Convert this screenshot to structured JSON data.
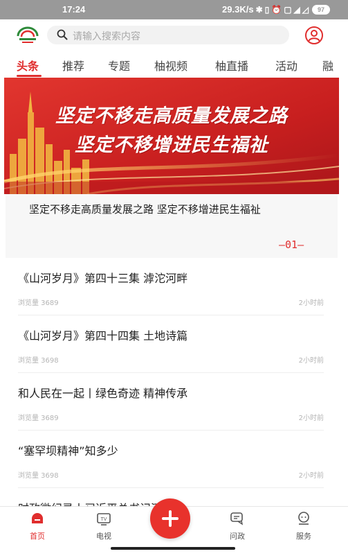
{
  "status_bar": {
    "time": "17:24",
    "network_speed": "29.3K/s",
    "battery_level": "97",
    "icons": [
      "bluetooth-icon",
      "vibrate-icon",
      "alarm-icon",
      "sim-icon",
      "signal-5g-icon",
      "wifi-icon",
      "battery-icon"
    ]
  },
  "header": {
    "logo_icon": "app-logo-icon",
    "search_placeholder": "请输入搜索内容",
    "user_icon": "user-profile-icon"
  },
  "tabs": [
    {
      "label": "头条",
      "active": true
    },
    {
      "label": "推荐",
      "active": false
    },
    {
      "label": "专题",
      "active": false
    },
    {
      "label": "柚视频",
      "active": false
    },
    {
      "label": "柚直播",
      "active": false
    },
    {
      "label": "活动",
      "active": false
    },
    {
      "label": "融",
      "active": false
    }
  ],
  "banner": {
    "line1": "坚定不移走高质量发展之路",
    "line2": "坚定不移增进民生福祉",
    "caption": "坚定不移走高质量发展之路 坚定不移增进民生福祉",
    "index": "—01—"
  },
  "news": [
    {
      "title": "《山河岁月》第四十三集 滹沱河畔",
      "views": "浏览量 3689",
      "time": "2小时前"
    },
    {
      "title": "《山河岁月》第四十四集 土地诗篇",
      "views": "浏览量 3698",
      "time": "2小时前"
    },
    {
      "title": "和人民在一起丨绿色奇迹 精神传承",
      "views": "浏览量 3689",
      "time": "2小时前"
    },
    {
      "title": "“塞罕坝精神”知多少",
      "views": "浏览量 3698",
      "time": "2小时前"
    },
    {
      "title": "时政微纪录丨习近平总书记河北行",
      "views": "",
      "time": ""
    }
  ],
  "bottom_nav": [
    {
      "label": "首页",
      "icon": "home-icon",
      "active": true
    },
    {
      "label": "电视",
      "icon": "tv-icon",
      "active": false
    },
    {
      "label": "问政",
      "icon": "chat-icon",
      "active": false
    },
    {
      "label": "服务",
      "icon": "service-icon",
      "active": false
    }
  ],
  "fab_icon": "plus-icon",
  "colors": {
    "accent": "#e02e2e",
    "status_bar": "#999999",
    "banner_red": "#d42a26",
    "banner_gold": "#f5c14a"
  }
}
